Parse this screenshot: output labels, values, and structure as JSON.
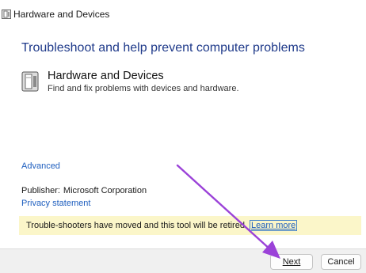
{
  "window": {
    "title": "Hardware and Devices",
    "icon": "hardware-devices-icon"
  },
  "main": {
    "heading": "Troubleshoot and help prevent computer problems",
    "troubleshooter": {
      "name": "Hardware and Devices",
      "description": "Find and fix problems with devices and hardware.",
      "icon": "hardware-devices-icon"
    },
    "advanced_link": "Advanced",
    "publisher_label": "Publisher:",
    "publisher_value": "Microsoft Corporation",
    "privacy_link": "Privacy statement"
  },
  "banner": {
    "message": "Trouble-shooters have moved and this tool will be retired.",
    "learn_more": "Learn more"
  },
  "footer": {
    "next_label": "Next",
    "cancel_label": "Cancel"
  },
  "colors": {
    "heading": "#1f3a8a",
    "link": "#1f5fbf",
    "banner_bg": "#fbf6c9",
    "annotation_arrow": "#9b42d8"
  }
}
